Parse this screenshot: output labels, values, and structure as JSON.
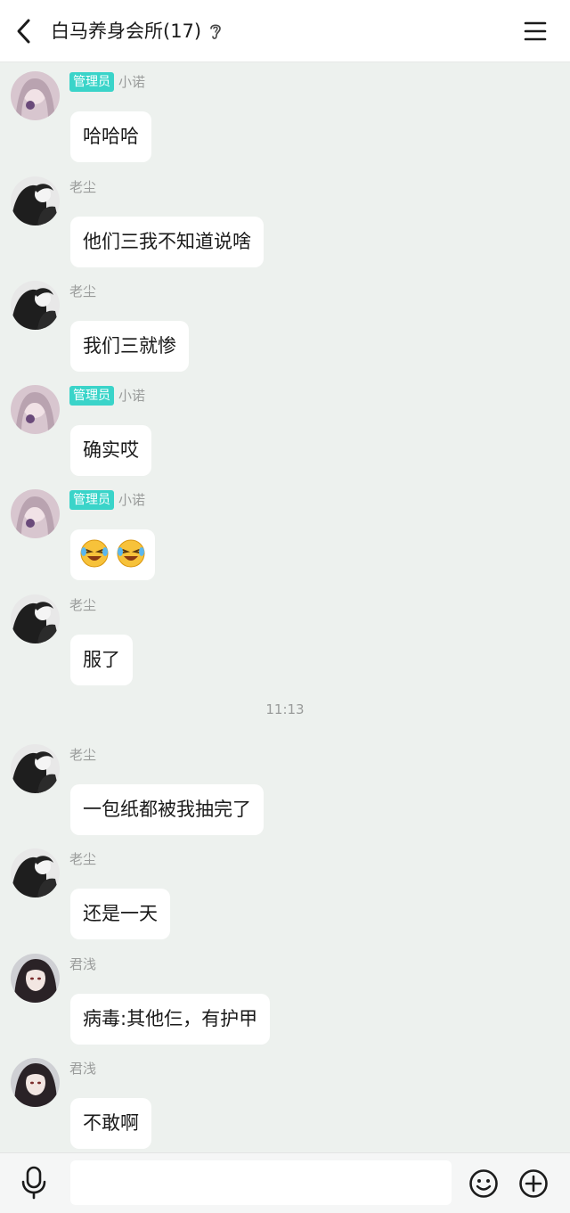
{
  "header": {
    "title": "白马养身会所(17)"
  },
  "time_separator": "11:13",
  "messages": [
    {
      "sender": "小诺",
      "badge": "管理员",
      "avatar": "avatar-pink-girl",
      "text": "哈哈哈"
    },
    {
      "sender": "老尘",
      "avatar": "avatar-bw-couple",
      "text": "他们三我不知道说啥"
    },
    {
      "sender": "老尘",
      "avatar": "avatar-bw-couple",
      "text": "我们三就惨"
    },
    {
      "sender": "小诺",
      "badge": "管理员",
      "avatar": "avatar-pink-girl",
      "text": "确实哎"
    },
    {
      "sender": "小诺",
      "badge": "管理员",
      "avatar": "avatar-pink-girl",
      "emoji": "laughing-crying-emoji",
      "emoji_count": 2
    },
    {
      "sender": "老尘",
      "avatar": "avatar-bw-couple",
      "text": "服了"
    },
    {
      "sender": "老尘",
      "avatar": "avatar-bw-couple",
      "text": "一包纸都被我抽完了"
    },
    {
      "sender": "老尘",
      "avatar": "avatar-bw-couple",
      "text": "还是一天"
    },
    {
      "sender": "君浅",
      "avatar": "avatar-dark-hair-girl",
      "text": "病毒:其他仨，有护甲"
    },
    {
      "sender": "君浅",
      "avatar": "avatar-dark-hair-girl",
      "text": "不敢啊"
    }
  ],
  "input": {
    "placeholder": ""
  },
  "colors": {
    "badge": "#3ad4c9",
    "chat_background": "#edf1ee",
    "bubble": "#ffffff"
  }
}
